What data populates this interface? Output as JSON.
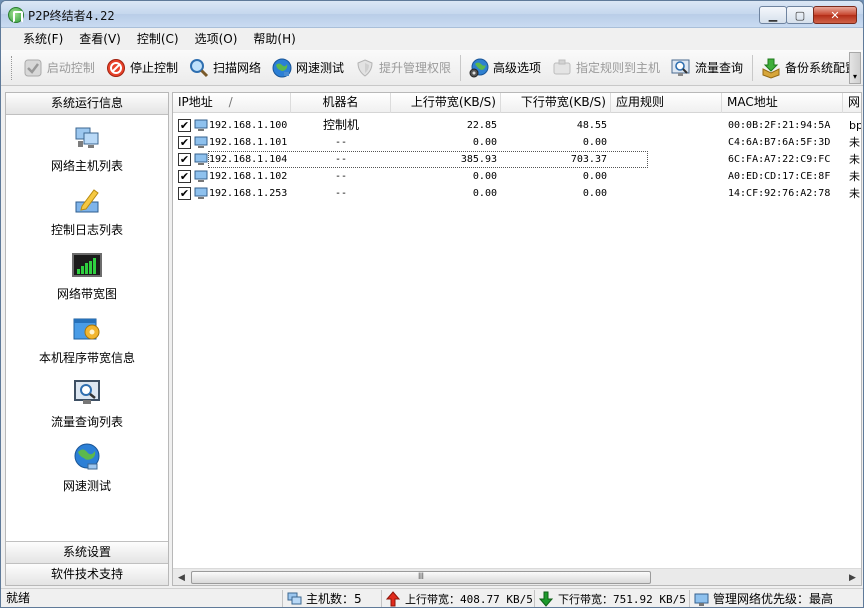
{
  "window": {
    "title": "P2P终结者4.22",
    "min": "▁",
    "max": "▢",
    "close": "✕"
  },
  "menu": [
    "系统(F)",
    "查看(V)",
    "控制(C)",
    "选项(O)",
    "帮助(H)"
  ],
  "toolbar": {
    "start_control": "启动控制",
    "stop_control": "停止控制",
    "scan_network": "扫描网络",
    "speed_test": "网速测试",
    "elevate_admin": "提升管理权限",
    "advanced_options": "高级选项",
    "assign_rule": "指定规则到主机",
    "traffic_query": "流量查询",
    "backup_config": "备份系统配置"
  },
  "sidebar": {
    "header": "系统运行信息",
    "items": [
      "网络主机列表",
      "控制日志列表",
      "网络带宽图",
      "本机程序带宽信息",
      "流量查询列表",
      "网速测试"
    ],
    "footer_settings": "系统设置",
    "footer_support": "软件技术支持"
  },
  "table": {
    "columns": {
      "ip": "IP地址",
      "sort_mark": "/",
      "machine": "机器名",
      "up": "上行带宽(KB/S)",
      "down": "下行带宽(KB/S)",
      "rule": "应用规则",
      "mac": "MAC地址",
      "extra": "网"
    },
    "rows": [
      {
        "checked": "✔",
        "ip": "192.168.1.100",
        "name": "控制机",
        "up": "22.85",
        "down": "48.55",
        "rule": "",
        "mac": "00:0B:2F:21:94:5A",
        "extra": "bp"
      },
      {
        "checked": "✔",
        "ip": "192.168.1.101",
        "name": "--",
        "up": "0.00",
        "down": "0.00",
        "rule": "",
        "mac": "C4:6A:B7:6A:5F:3D",
        "extra": "未"
      },
      {
        "checked": "✔",
        "ip": "192.168.1.104",
        "name": "--",
        "up": "385.93",
        "down": "703.37",
        "rule": "",
        "mac": "6C:FA:A7:22:C9:FC",
        "extra": "未"
      },
      {
        "checked": "✔",
        "ip": "192.168.1.102",
        "name": "--",
        "up": "0.00",
        "down": "0.00",
        "rule": "",
        "mac": "A0:ED:CD:17:CE:8F",
        "extra": "未"
      },
      {
        "checked": "✔",
        "ip": "192.168.1.253",
        "name": "--",
        "up": "0.00",
        "down": "0.00",
        "rule": "",
        "mac": "14:CF:92:76:A2:78",
        "extra": "未"
      }
    ]
  },
  "hscroll": {
    "left": "◀",
    "right": "▶",
    "grip": "Ⅲ"
  },
  "status": {
    "ready": "就绪",
    "hosts": "主机数：5",
    "upload": "上行带宽：408.77 KB/5",
    "download": "下行带宽：751.92 KB/5",
    "priority": "管理网络优先级：最高"
  }
}
